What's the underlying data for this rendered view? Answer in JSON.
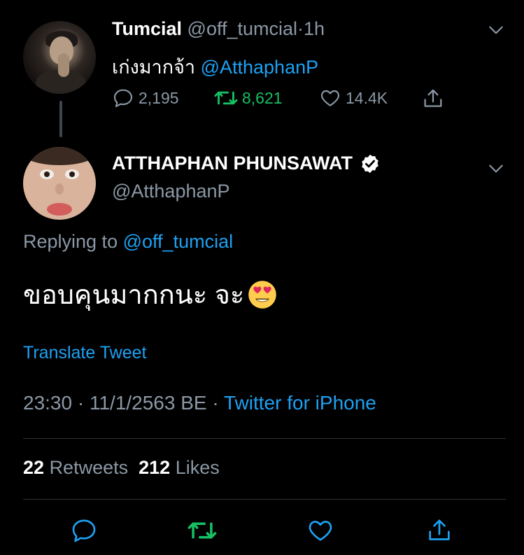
{
  "parent_tweet": {
    "display_name": "Tumcial",
    "handle": "@off_tumcial",
    "separator": "·",
    "time_ago": "1h",
    "text": "เก่งมากจ้า",
    "mention": "@AtthaphanP",
    "actions": {
      "reply_count": "2,195",
      "retweet_count": "8,621",
      "like_count": "14.4K"
    }
  },
  "reply_tweet": {
    "display_name": "ATTHAPHAN PHUNSAWAT",
    "verified": true,
    "handle": "@AtthaphanP",
    "replying_label": "Replying to",
    "replying_to": "@off_tumcial",
    "text": "ขอบคุนมากกนะ จะ",
    "emoji": "heart-eyes-emoji",
    "translate_label": "Translate Tweet",
    "time": "23:30",
    "dot": "·",
    "date": "11/1/2563 BE",
    "dot2": "·",
    "source": "Twitter for iPhone",
    "retweets_count": "22",
    "retweets_label": "Retweets",
    "likes_count": "212",
    "likes_label": "Likes"
  },
  "colors": {
    "background": "#000000",
    "text_primary": "#ffffff",
    "text_secondary": "#8b98a5",
    "link_blue": "#1da1f2",
    "retweet_green": "#17bf63",
    "divider": "#2f3336"
  },
  "icons": {
    "reply": "reply-icon",
    "retweet": "retweet-icon",
    "like": "heart-icon",
    "share": "share-icon",
    "chevron": "chevron-down-icon",
    "verified": "verified-badge-icon"
  }
}
